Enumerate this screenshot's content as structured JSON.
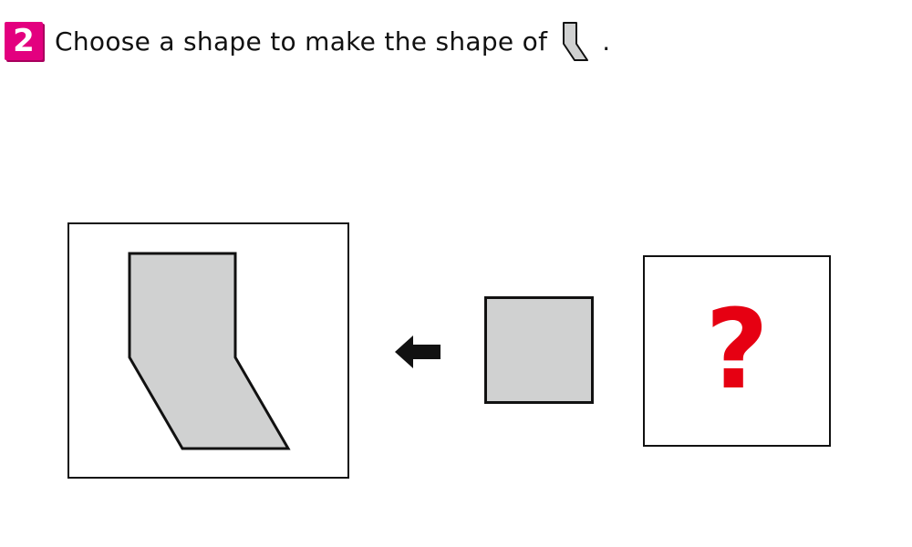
{
  "question": {
    "number": "2",
    "text": "Choose a shape to make the shape of",
    "end_punctuation": ".",
    "accent_color": "#e3007f"
  },
  "shapes": {
    "fill_color": "#d0d1d1",
    "stroke_color": "#111111"
  },
  "answer_box": {
    "placeholder": "?",
    "placeholder_color": "#e60012"
  },
  "icons": {
    "arrow": "arrow-left-icon",
    "target": "bent-shape-icon",
    "piece": "square-shape-icon"
  }
}
